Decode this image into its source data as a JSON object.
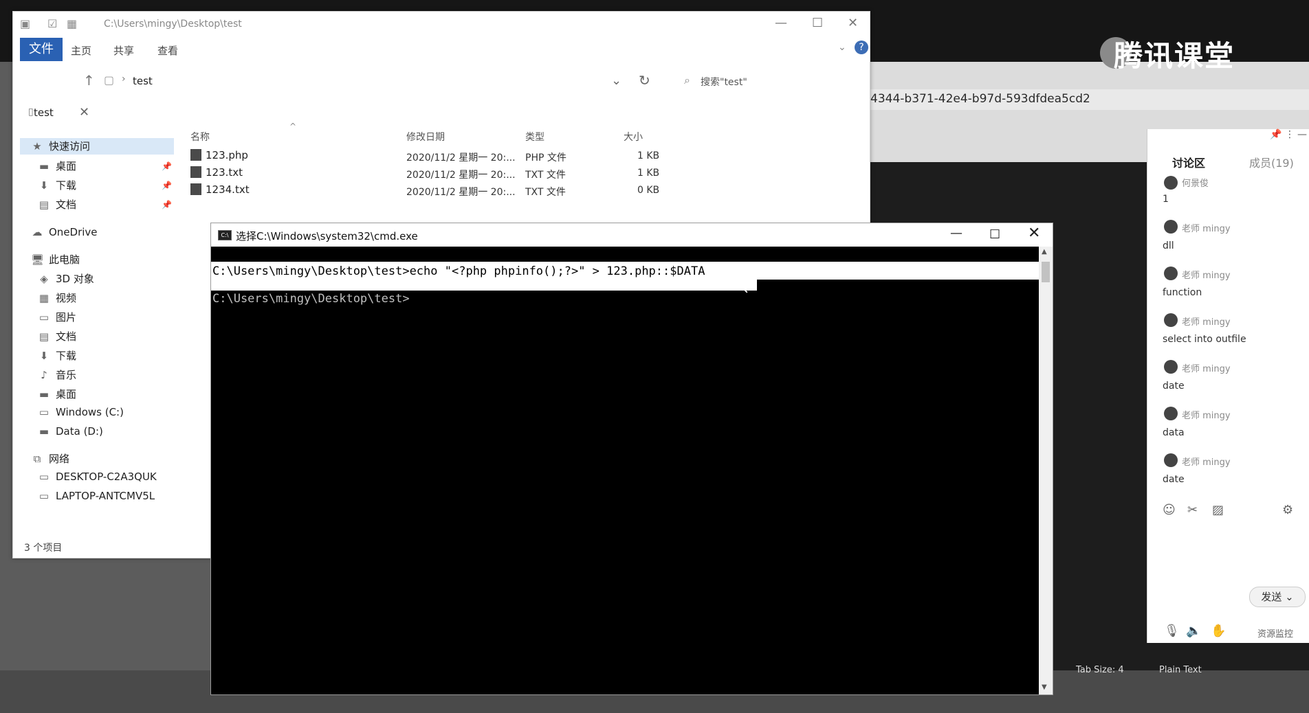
{
  "background": {
    "logo_text": "腾讯课堂",
    "url_fragment": "4344-b371-42e4-b97d-593dfdea5cd2",
    "editor_status_tab": "Tab Size: 4",
    "editor_status_plain": "Plain Text"
  },
  "explorer": {
    "title_path": "C:\\Users\\mingy\\Desktop\\test",
    "ribbon_tabs": [
      "文件",
      "主页",
      "共享",
      "查看"
    ],
    "breadcrumb": "test",
    "search_placeholder": "搜索\"test\"",
    "tab_label": "test",
    "columns": [
      "名称",
      "修改日期",
      "类型",
      "大小"
    ],
    "files": [
      {
        "name": "123.php",
        "modified": "2020/11/2 星期一 20:...",
        "type": "PHP 文件",
        "size": "1 KB"
      },
      {
        "name": "123.txt",
        "modified": "2020/11/2 星期一 20:...",
        "type": "TXT 文件",
        "size": "1 KB"
      },
      {
        "name": "1234.txt",
        "modified": "2020/11/2 星期一 20:...",
        "type": "TXT 文件",
        "size": "0 KB"
      }
    ],
    "nav": {
      "quick_access": "快速访问",
      "quick_items": [
        "桌面",
        "下载",
        "文档"
      ],
      "onedrive": "OneDrive",
      "this_pc": "此电脑",
      "pc_items": [
        "3D 对象",
        "视频",
        "图片",
        "文档",
        "下载",
        "音乐",
        "桌面",
        "Windows (C:)",
        "Data (D:)"
      ],
      "network": "网络",
      "network_items": [
        "DESKTOP-C2A3QUK",
        "LAPTOP-ANTCMV5L"
      ]
    },
    "status": "3 个项目"
  },
  "cmd": {
    "title": "选择C:\\Windows\\system32\\cmd.exe",
    "line1": "C:\\Users\\mingy\\Desktop\\test>echo \"<?php phpinfo();?>\" > 123.php::$DATA",
    "line2": "C:\\Users\\mingy\\Desktop\\test>"
  },
  "chat": {
    "tab_discussion": "讨论区",
    "tab_members": "成员(19)",
    "messages": [
      {
        "sender": "何景俊",
        "text": "1"
      },
      {
        "sender": "老师 mingy",
        "text": "dll"
      },
      {
        "sender": "老师 mingy",
        "text": "function"
      },
      {
        "sender": "老师 mingy",
        "text": "select into outfile"
      },
      {
        "sender": "老师 mingy",
        "text": "date"
      },
      {
        "sender": "老师 mingy",
        "text": "data"
      },
      {
        "sender": "老师 mingy",
        "text": "date"
      }
    ],
    "send_label": "发送",
    "resource_monitor": "资源监控"
  }
}
